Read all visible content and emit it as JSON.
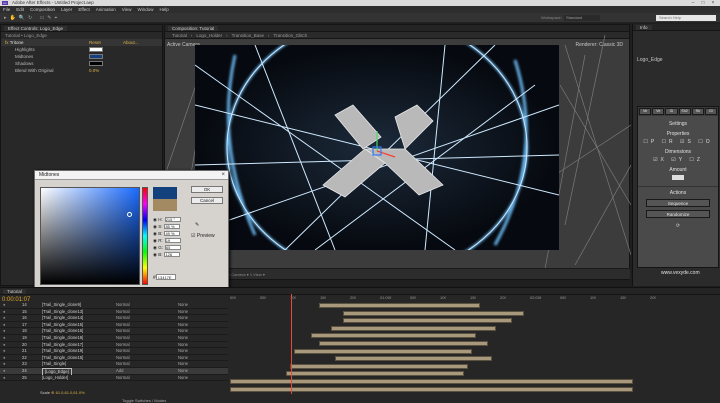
{
  "window": {
    "title": "Adobe After Effects - Untitled Project.aep"
  },
  "menu": [
    "File",
    "Edit",
    "Composition",
    "Layer",
    "Effect",
    "Animation",
    "View",
    "Window",
    "Help"
  ],
  "toolbar": {
    "workspace_label": "Workspace:",
    "workspace_value": "Standard",
    "search_placeholder": "Search Help"
  },
  "effect_controls": {
    "tab": "Effect Controls: Logo_Edge",
    "breadcrumb": "Tutorial • Logo_Edge",
    "effect_name": "Tritone",
    "reset": "Reset",
    "about": "About...",
    "rows": [
      {
        "label": "Highlights",
        "color": "#ffffff"
      },
      {
        "label": "Midtones",
        "color": "#15417e"
      },
      {
        "label": "Shadows",
        "color": "#000000"
      },
      {
        "label": "Blend With Original",
        "value": "0.0%"
      }
    ]
  },
  "composition": {
    "tab": "Composition: Tutorial",
    "crumbs": [
      "Tutorial",
      "Logo_Holder",
      "Transition_Base",
      "Transition_Glitch"
    ],
    "active_camera": "Active Camera",
    "renderer": "Renderer: Classic 3D",
    "footer": "(50%) ▾   Full ▾   Active Camera ▾   1 View ▾"
  },
  "dialog": {
    "title": "Midtones",
    "ok": "OK",
    "cancel": "Cancel",
    "preview": "Preview",
    "fields": [
      {
        "label": "H:",
        "value": "215 °"
      },
      {
        "label": "S:",
        "value": "85 %"
      },
      {
        "label": "B:",
        "value": "49 %"
      },
      {
        "label": "R:",
        "value": "19"
      },
      {
        "label": "G:",
        "value": "65"
      },
      {
        "label": "B:",
        "value": "126"
      }
    ],
    "hex": "13417E",
    "new_color": "#13417e",
    "old_color": "#a48a62"
  },
  "right_panel": {
    "title": "Info",
    "sub": "Logo_Edge",
    "settings_label": "Settings",
    "properties_label": "Properties",
    "dimensions_label": "Dimensions",
    "amount_label": "Amount",
    "actions_label": "Actions",
    "sequence_btn": "Sequence",
    "randomize_btn": "Randomize",
    "website": "www.vexyde.com",
    "tabs": [
      "Ve",
      "Ve",
      "Gl",
      "Sh2",
      "Sh",
      "Gl"
    ]
  },
  "timeline": {
    "tab": "Tutorial",
    "timecode": "0:00:01:07",
    "fps": "00037 (30.00 fps)",
    "columns": [
      "#",
      "Layer Name",
      "Mode",
      "T",
      "TrkMat",
      "Parent"
    ],
    "ticks": [
      "00f",
      "05f",
      "10f",
      "15f",
      "20f",
      "01:00f",
      "05f",
      "10f",
      "15f",
      "20f",
      "02:00f",
      "05f",
      "10f",
      "15f",
      "20f"
    ],
    "layers": [
      {
        "num": "14",
        "name": "[Trail_Single_clone9]",
        "mode": "Normal",
        "parent": "None",
        "start": 0.22,
        "end": 0.62
      },
      {
        "num": "15",
        "name": "[Trail_Single_clone13]",
        "mode": "Normal",
        "parent": "None",
        "start": 0.28,
        "end": 0.73
      },
      {
        "num": "16",
        "name": "[Trail_Single_clone14]",
        "mode": "Normal",
        "parent": "None",
        "start": 0.28,
        "end": 0.7
      },
      {
        "num": "17",
        "name": "[Trail_Single_clone15]",
        "mode": "Normal",
        "parent": "None",
        "start": 0.25,
        "end": 0.66
      },
      {
        "num": "18",
        "name": "[Trail_Single_clone16]",
        "mode": "Normal",
        "parent": "None",
        "start": 0.2,
        "end": 0.61
      },
      {
        "num": "19",
        "name": "[Trail_Single_clone18]",
        "mode": "Normal",
        "parent": "None",
        "start": 0.22,
        "end": 0.64
      },
      {
        "num": "20",
        "name": "[Trail_Single_clone17]",
        "mode": "Normal",
        "parent": "None",
        "start": 0.16,
        "end": 0.6
      },
      {
        "num": "21",
        "name": "[Trail_Single_clone19]",
        "mode": "Normal",
        "parent": "None",
        "start": 0.26,
        "end": 0.65
      },
      {
        "num": "22",
        "name": "[Trail_Single_clone15]",
        "mode": "Normal",
        "parent": "None",
        "start": 0.15,
        "end": 0.59
      },
      {
        "num": "23",
        "name": "[Trail_Single]",
        "mode": "Normal",
        "parent": "None",
        "start": 0.14,
        "end": 0.58
      },
      {
        "num": "24",
        "name": "[Logo_Edge]",
        "mode": "Add",
        "parent": "None",
        "start": 0.0,
        "end": 1.0
      },
      {
        "num": "25",
        "name": "[Logo_Holder]",
        "mode": "Normal",
        "parent": "None",
        "start": 0.0,
        "end": 1.0
      }
    ],
    "switch_label": "Toggle Switches / Modes",
    "scale_label": "Scale",
    "scale_value": "⊕ 61.0,61.0,61.0%"
  }
}
